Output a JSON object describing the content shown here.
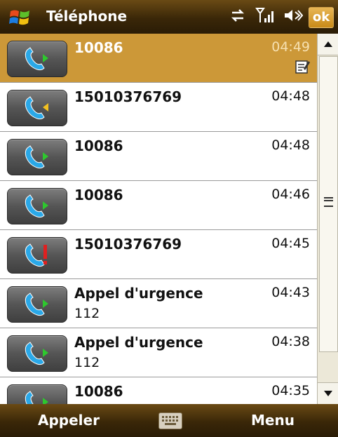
{
  "header": {
    "title": "Téléphone",
    "ok_label": "ok",
    "icons": [
      "windows-start-icon",
      "sync-arrows-icon",
      "signal-strength-icon",
      "speaker-volume-icon"
    ]
  },
  "calls": [
    {
      "name": "10086",
      "sub": "",
      "time": "04:49",
      "type": "outgoing",
      "selected": true,
      "has_note": true
    },
    {
      "name": "15010376769",
      "sub": "",
      "time": "04:48",
      "type": "incoming",
      "selected": false,
      "has_note": false
    },
    {
      "name": "10086",
      "sub": "",
      "time": "04:48",
      "type": "outgoing",
      "selected": false,
      "has_note": false
    },
    {
      "name": "10086",
      "sub": "",
      "time": "04:46",
      "type": "outgoing",
      "selected": false,
      "has_note": false
    },
    {
      "name": "15010376769",
      "sub": "",
      "time": "04:45",
      "type": "missed",
      "selected": false,
      "has_note": false
    },
    {
      "name": "Appel d'urgence",
      "sub": "112",
      "time": "04:43",
      "type": "outgoing",
      "selected": false,
      "has_note": false
    },
    {
      "name": "Appel d'urgence",
      "sub": "112",
      "time": "04:38",
      "type": "outgoing",
      "selected": false,
      "has_note": false
    },
    {
      "name": "10086",
      "sub": "",
      "time": "04:35",
      "type": "outgoing",
      "selected": false,
      "has_note": false
    }
  ],
  "softkeys": {
    "left": "Appeler",
    "right": "Menu"
  },
  "colors": {
    "bar_dark": "#3a2708",
    "selected_row": "#cc9838",
    "phone_blue": "#2aa8e8",
    "arrow_green": "#2ec82e",
    "arrow_yellow": "#f2c020",
    "missed_red": "#e02020"
  }
}
